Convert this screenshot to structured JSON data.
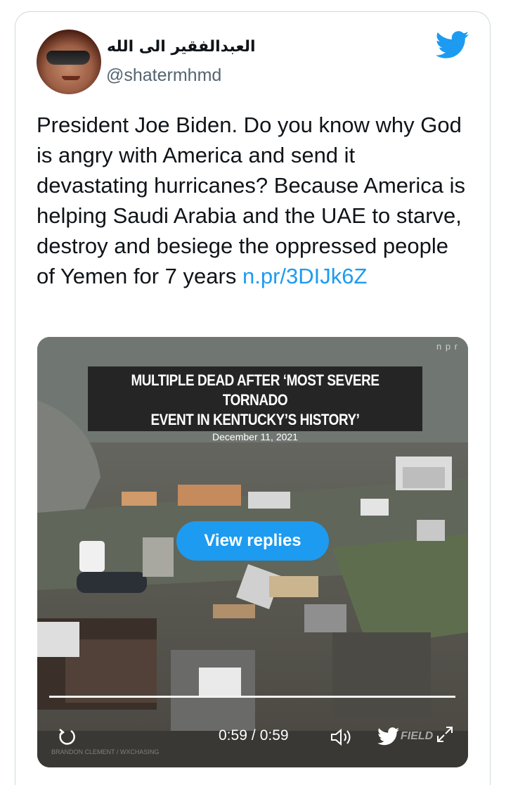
{
  "tweet": {
    "display_name": "العبدالفقير الى الله",
    "handle": "@shatermhmd",
    "text": "President Joe Biden. Do you know why God is angry with America and send it devastating hurricanes? Because America is helping Saudi Arabia and the UAE to starve, destroy and besiege the oppressed people of Yemen for 7 years",
    "link": "n.pr/3DIJk6Z"
  },
  "media": {
    "headline_line1": "MULTIPLE DEAD AFTER ‘MOST SEVERE TORNADO",
    "headline_line2": "EVENT IN KENTUCKY’S HISTORY’",
    "date": "December 11, 2021",
    "source_logo": "n p r",
    "view_replies_label": "View replies",
    "progress": 1.0,
    "time_current": "0:59",
    "time_separator": "/",
    "time_total": "0:59",
    "watermark": "FIELD",
    "credit": "BRANDON CLEMENT / WXCHASING"
  },
  "colors": {
    "accent": "#1d9bf0",
    "text": "#0f1419",
    "muted": "#536471",
    "border": "#cfd9de"
  },
  "icons": [
    "twitter-bird-icon",
    "replay-icon",
    "volume-icon",
    "twitter-bird-icon",
    "expand-icon"
  ]
}
